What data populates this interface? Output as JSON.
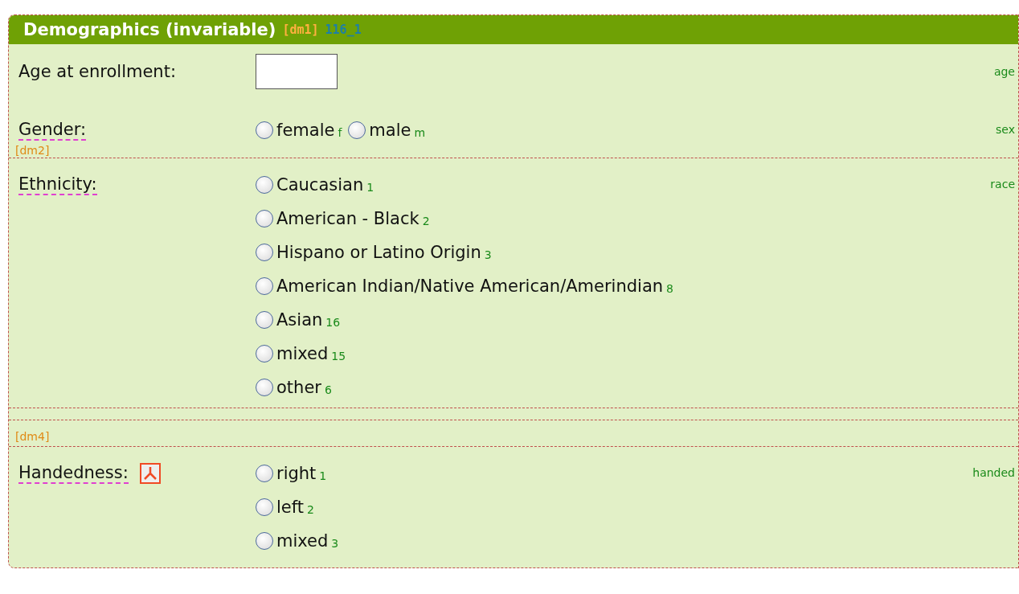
{
  "header": {
    "title": "Demographics (invariable)",
    "tag": "[dm1]",
    "code": "116_1"
  },
  "sections": [
    {
      "fields": [
        {
          "label": "Age at enrollment:",
          "kind": "text",
          "annotated": false,
          "variable": "age"
        },
        {
          "label": "Gender:",
          "kind": "inline_choice",
          "annotated": true,
          "variable": "sex",
          "options": [
            {
              "label": "female",
              "code": "f",
              "selected": false
            },
            {
              "label": "male",
              "code": "m",
              "selected": false
            }
          ]
        }
      ]
    },
    {
      "tag": "[dm2]",
      "fields": [
        {
          "label": "Ethnicity:",
          "kind": "stacked_choice",
          "annotated": true,
          "variable": "race",
          "options": [
            {
              "label": "Caucasian",
              "code": "1",
              "selected": false
            },
            {
              "label": "American - Black",
              "code": "2",
              "selected": false
            },
            {
              "label": "Hispano or Latino Origin",
              "code": "3",
              "selected": false
            },
            {
              "label": "American Indian/Native American/Amerindian",
              "code": "8",
              "selected": false
            },
            {
              "label": "Asian",
              "code": "16",
              "selected": false
            },
            {
              "label": "mixed",
              "code": "15",
              "selected": false
            },
            {
              "label": "other",
              "code": "6",
              "selected": false
            }
          ]
        }
      ]
    },
    {
      "tag": "[dm4]",
      "fields": [
        {
          "label": "Handedness:",
          "kind": "stacked_choice",
          "annotated": true,
          "document_icon": true,
          "variable": "handed",
          "options": [
            {
              "label": "right",
              "code": "1",
              "selected": false
            },
            {
              "label": "left",
              "code": "2",
              "selected": false
            },
            {
              "label": "mixed",
              "code": "3",
              "selected": false
            }
          ]
        }
      ]
    }
  ]
}
